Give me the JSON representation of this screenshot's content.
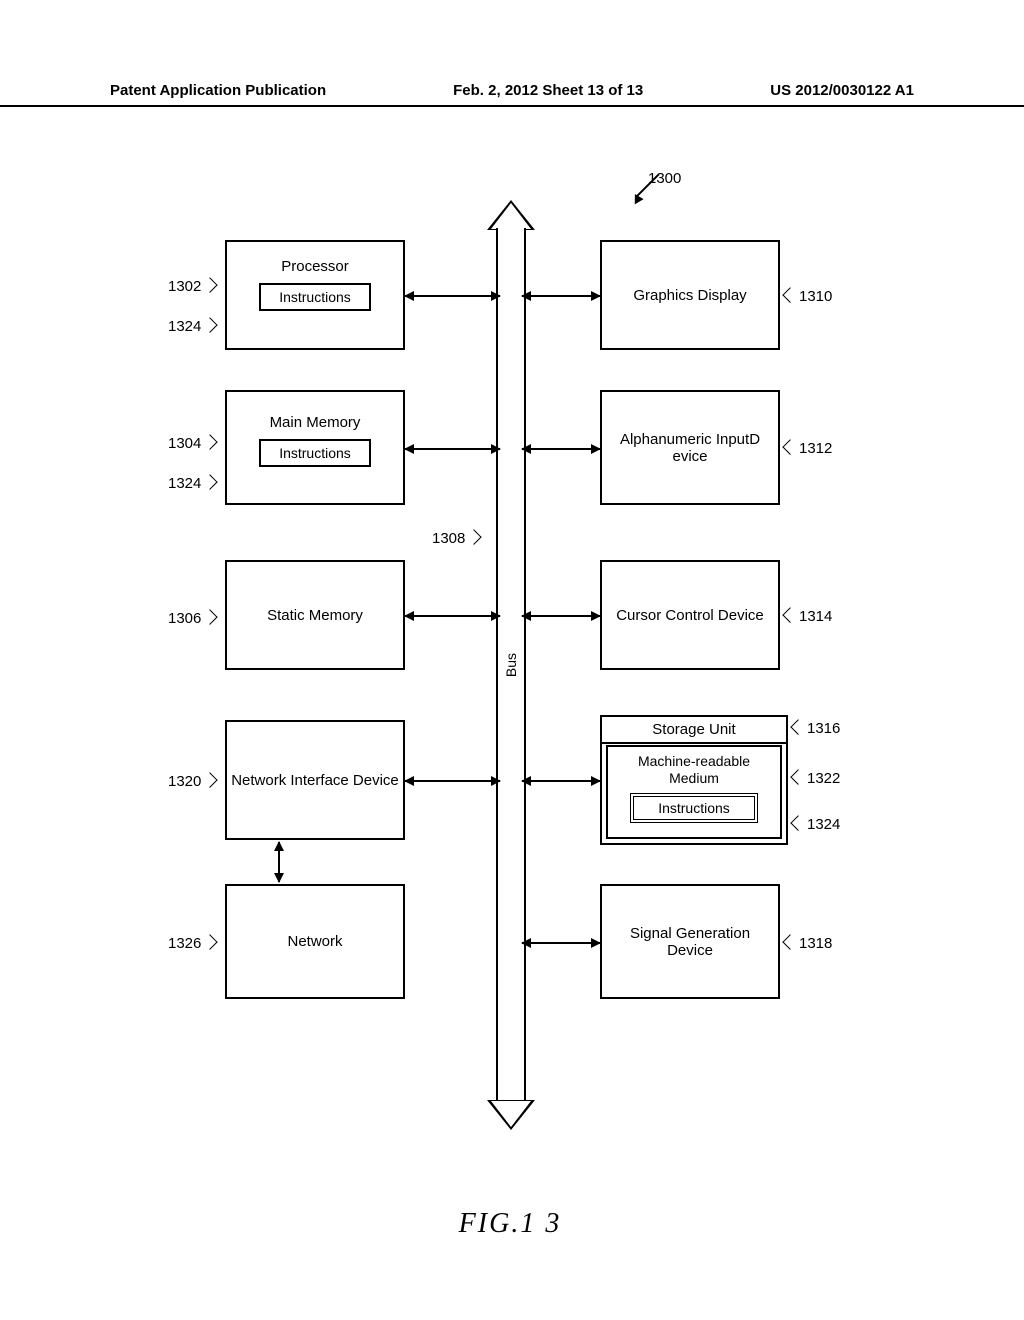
{
  "header": {
    "left": "Patent Application Publication",
    "center": "Feb. 2, 2012   Sheet 13 of 13",
    "right": "US 2012/0030122 A1"
  },
  "figure": {
    "caption": "FIG.1 3",
    "system_ref": "1300",
    "bus_label": "Bus",
    "bus_ref": "1308",
    "left_blocks": [
      {
        "title": "Processor",
        "inner": "Instructions",
        "ref": "1302",
        "inner_ref": "1324"
      },
      {
        "title": "Main Memory",
        "inner": "Instructions",
        "ref": "1304",
        "inner_ref": "1324"
      },
      {
        "title": "Static Memory",
        "ref": "1306"
      },
      {
        "title": "Network Interface Device",
        "ref": "1320"
      },
      {
        "title": "Network",
        "ref": "1326"
      }
    ],
    "right_blocks": [
      {
        "title": "Graphics Display",
        "ref": "1310"
      },
      {
        "title": "Alphanumeric InputD evice",
        "ref": "1312"
      },
      {
        "title": "Cursor Control Device",
        "ref": "1314"
      },
      {
        "storage_title": "Storage Unit",
        "medium_title": "Machine-readable Medium",
        "inner": "Instructions",
        "ref": "1316",
        "medium_ref": "1322",
        "inner_ref": "1324"
      },
      {
        "title": "Signal Generation Device",
        "ref": "1318"
      }
    ]
  }
}
